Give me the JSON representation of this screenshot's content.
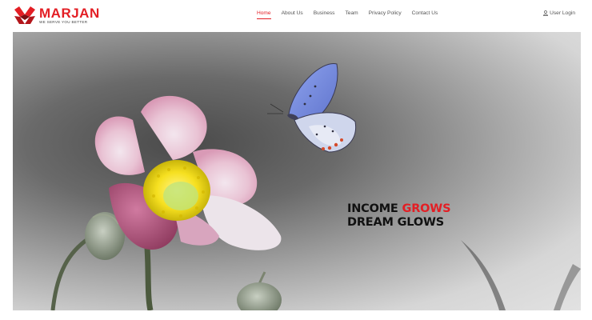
{
  "brand": {
    "name": "MARJAN",
    "tagline": "WE SERVE YOU BETTER",
    "color": "#e31e24"
  },
  "nav": {
    "items": [
      {
        "label": "Home",
        "active": true
      },
      {
        "label": "About Us",
        "active": false
      },
      {
        "label": "Business",
        "active": false
      },
      {
        "label": "Team",
        "active": false
      },
      {
        "label": "Privacy Policy",
        "active": false
      },
      {
        "label": "Contact Us",
        "active": false
      }
    ],
    "login_label": "User Login",
    "login_icon": "user-icon"
  },
  "hero": {
    "line1_a": "INCOME",
    "line1_b": "GROWS",
    "line2": "DREAM GLOWS",
    "accent_color": "#e31e24"
  }
}
